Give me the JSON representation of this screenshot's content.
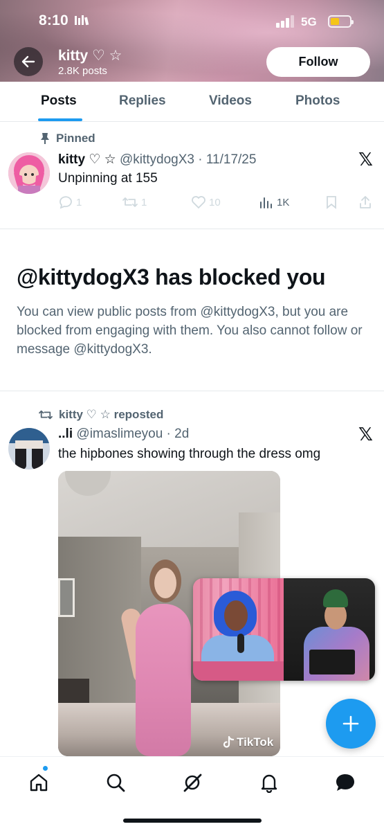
{
  "status_bar": {
    "time": "8:10",
    "network": "5G",
    "battery_color": "#f5c518"
  },
  "header": {
    "profile_name": "kitty ♡ ☆",
    "post_count": "2.8K posts",
    "follow_label": "Follow",
    "back_icon": "arrow-left-icon"
  },
  "tabs": [
    {
      "label": "Posts",
      "active": true
    },
    {
      "label": "Replies",
      "active": false
    },
    {
      "label": "Videos",
      "active": false
    },
    {
      "label": "Photos",
      "active": false
    }
  ],
  "pinned_post": {
    "pinned_label": "Pinned",
    "author_name": "kitty ♡ ☆",
    "handle_date": "@kittydogX3 · 11/17/25",
    "text": "Unpinning at 155",
    "replies": "1",
    "reposts": "1",
    "likes": "10",
    "views": "1K"
  },
  "blocked": {
    "title": "@kittydogX3 has blocked you",
    "description": "You can view public posts from @kittydogX3, but you are blocked from engaging with them. You also cannot follow or message @kittydogX3."
  },
  "repost": {
    "repost_label": "kitty ♡ ☆ reposted",
    "author_name": "..li",
    "handle_date": "@imaslimeyou · 2d",
    "text": "the hipbones showing through the dress omg",
    "video_watermark": "TikTok"
  },
  "bottom_nav": {
    "items": [
      "home-icon",
      "search-icon",
      "grok-icon",
      "notifications-icon",
      "messages-icon"
    ]
  },
  "colors": {
    "accent": "#1d9bf0",
    "text_primary": "#0f1419",
    "text_secondary": "#536471"
  }
}
